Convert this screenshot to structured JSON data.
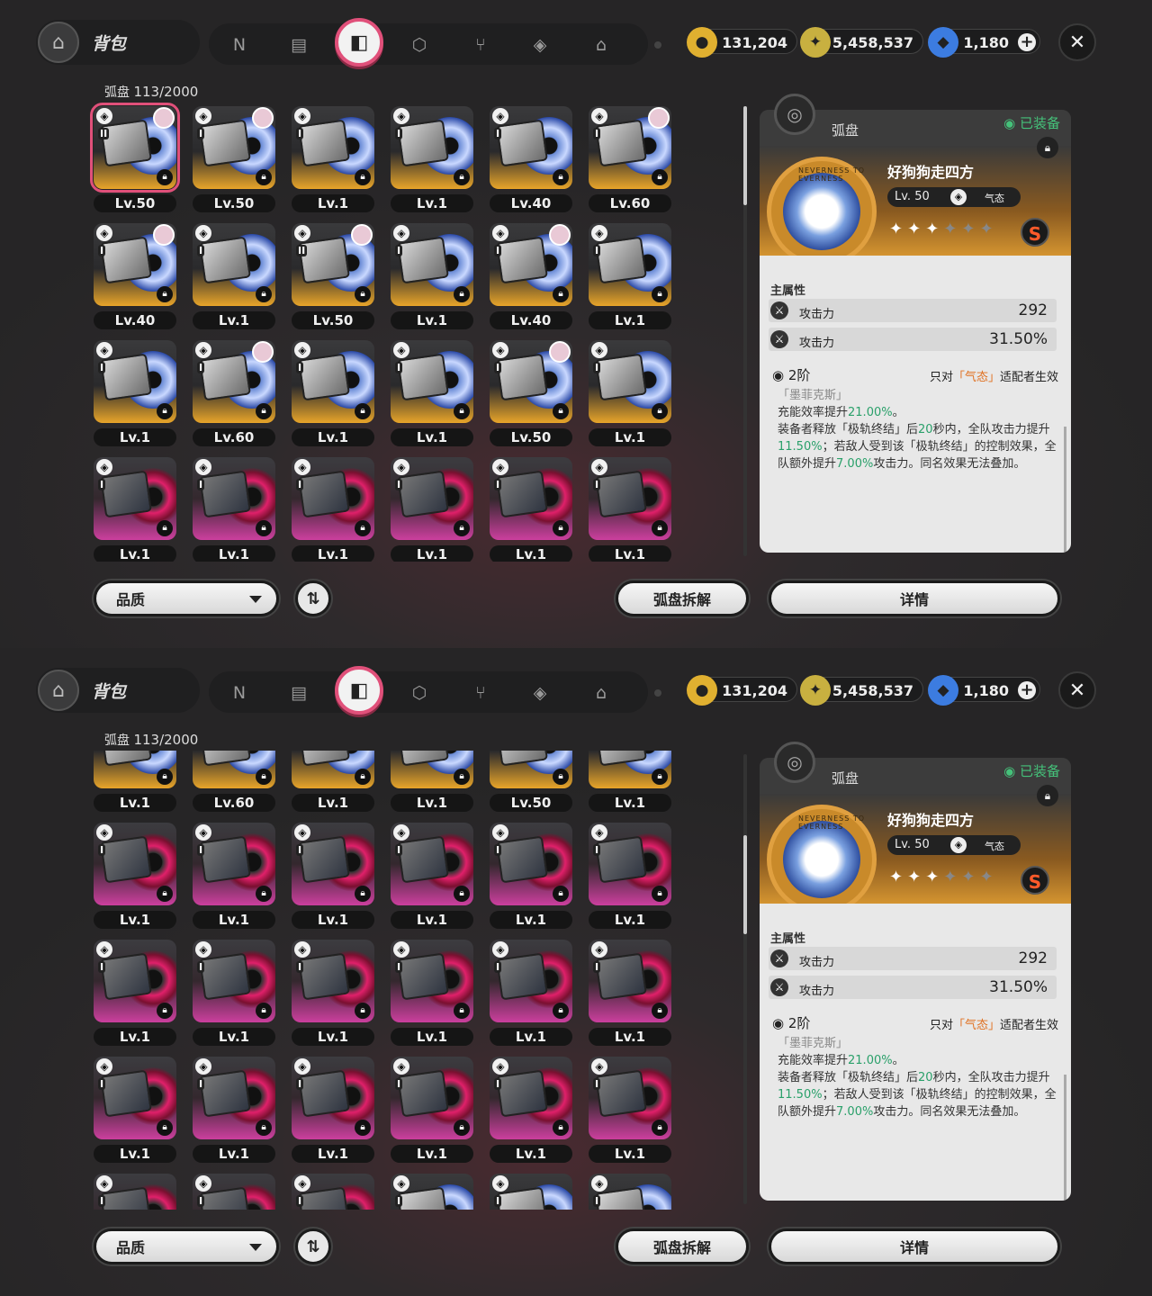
{
  "header": {
    "title": "背包",
    "tabs": [
      {
        "icon": "n-logo-icon",
        "glyph": "N"
      },
      {
        "icon": "gameboy-icon",
        "glyph": "▤"
      },
      {
        "icon": "disc-bag-icon",
        "glyph": "◧",
        "active": true
      },
      {
        "icon": "cube-icon",
        "glyph": "⬡"
      },
      {
        "icon": "utensils-icon",
        "glyph": "⑂"
      },
      {
        "icon": "cube-outline-icon",
        "glyph": "◈"
      },
      {
        "icon": "house-icon",
        "glyph": "⌂"
      }
    ],
    "currencies": [
      {
        "icon": "coin-icon",
        "value": "131,204",
        "color": "#e0b030"
      },
      {
        "icon": "ticket-icon",
        "value": "5,458,537",
        "color": "#c8b040"
      },
      {
        "icon": "polychrome-icon",
        "value": "1,180",
        "color": "#3c7ce0"
      }
    ],
    "close": "✕"
  },
  "inventory": {
    "label": "弧盘",
    "count": "113/2000"
  },
  "filter": {
    "label": "品质"
  },
  "buttons": {
    "sort": "⇅",
    "dismantle": "弧盘拆解",
    "details": "详情"
  },
  "panel": {
    "title": "弧盘",
    "equipped": "已装备",
    "name": "好狗狗走四方",
    "level": "Lv. 50",
    "attribute": "气态",
    "medal_text": "NEVERNESS TO EVERNESS",
    "stars_filled": 3,
    "stars_total": 6,
    "rank": "S",
    "main_label": "主属性",
    "stats": [
      {
        "name": "攻击力",
        "value": "292"
      },
      {
        "name": "攻击力",
        "value": "31.50%"
      }
    ],
    "tier": "2阶",
    "tier_hint_pre": "只对",
    "tier_hint_attr": "「气态」",
    "tier_hint_post": "适配者生效",
    "desc_sub": "「墨菲克斯」",
    "desc_l1_a": "充能效率提升",
    "desc_l1_b": "21.00%",
    "desc_l1_c": "。",
    "desc_l2_a": "装备者释放「极轨终结」后",
    "desc_l2_b": "20",
    "desc_l2_c": "秒内，全队攻击力提升",
    "desc_l2_d": "11.50%",
    "desc_l2_e": "；若敌人受到该「极轨终结」的控制效果，全队额外提升",
    "desc_l2_f": "7.00%",
    "desc_l2_g": "攻击力。同名效果无法叠加。"
  },
  "screen_top": {
    "rows": [
      [
        {
          "attr": "◈",
          "rank": "II",
          "av": true,
          "lv": "Lv.50",
          "g": "y",
          "sel": true
        },
        {
          "attr": "◈",
          "rank": "I",
          "av": true,
          "lv": "Lv.50",
          "g": "y"
        },
        {
          "attr": "◈",
          "rank": "I",
          "av": false,
          "lv": "Lv.1",
          "g": "y"
        },
        {
          "attr": "◈",
          "rank": "I",
          "av": false,
          "lv": "Lv.1",
          "g": "y"
        },
        {
          "attr": "◈",
          "rank": "I",
          "av": false,
          "lv": "Lv.40",
          "g": "y"
        },
        {
          "attr": "◈",
          "rank": "I",
          "av": true,
          "lv": "Lv.60",
          "g": "y"
        }
      ],
      [
        {
          "attr": "◈",
          "rank": "I",
          "av": true,
          "lv": "Lv.40",
          "g": "y"
        },
        {
          "attr": "◈",
          "rank": "I",
          "av": false,
          "lv": "Lv.1",
          "g": "y"
        },
        {
          "attr": "◈",
          "rank": "II",
          "av": true,
          "lv": "Lv.50",
          "g": "y"
        },
        {
          "attr": "◈",
          "rank": "I",
          "av": false,
          "lv": "Lv.1",
          "g": "y"
        },
        {
          "attr": "◈",
          "rank": "I",
          "av": true,
          "lv": "Lv.40",
          "g": "y"
        },
        {
          "attr": "◈",
          "rank": "I",
          "av": false,
          "lv": "Lv.1",
          "g": "y"
        }
      ],
      [
        {
          "attr": "◈",
          "rank": "I",
          "av": false,
          "lv": "Lv.1",
          "g": "y"
        },
        {
          "attr": "◈",
          "rank": "I",
          "av": true,
          "lv": "Lv.60",
          "g": "y"
        },
        {
          "attr": "◈",
          "rank": "I",
          "av": false,
          "lv": "Lv.1",
          "g": "y"
        },
        {
          "attr": "◈",
          "rank": "I",
          "av": false,
          "lv": "Lv.1",
          "g": "y"
        },
        {
          "attr": "◈",
          "rank": "I",
          "av": true,
          "lv": "Lv.50",
          "g": "y"
        },
        {
          "attr": "◈",
          "rank": "I",
          "av": false,
          "lv": "Lv.1",
          "g": "y"
        }
      ],
      [
        {
          "attr": "◈",
          "rank": "I",
          "av": false,
          "lv": "Lv.1",
          "g": "p"
        },
        {
          "attr": "◈",
          "rank": "I",
          "av": false,
          "lv": "Lv.1",
          "g": "p"
        },
        {
          "attr": "◈",
          "rank": "I",
          "av": false,
          "lv": "Lv.1",
          "g": "p"
        },
        {
          "attr": "◈",
          "rank": "I",
          "av": false,
          "lv": "Lv.1",
          "g": "p"
        },
        {
          "attr": "◈",
          "rank": "I",
          "av": false,
          "lv": "Lv.1",
          "g": "p"
        },
        {
          "attr": "◈",
          "rank": "I",
          "av": false,
          "lv": "Lv.1",
          "g": "p"
        }
      ]
    ]
  },
  "screen_bottom": {
    "rows": [
      [
        {
          "attr": "◈",
          "rank": "I",
          "av": false,
          "lv": "Lv.1",
          "g": "y"
        },
        {
          "attr": "◈",
          "rank": "I",
          "av": false,
          "lv": "Lv.60",
          "g": "y"
        },
        {
          "attr": "◈",
          "rank": "I",
          "av": false,
          "lv": "Lv.1",
          "g": "y"
        },
        {
          "attr": "◈",
          "rank": "I",
          "av": false,
          "lv": "Lv.1",
          "g": "y"
        },
        {
          "attr": "◈",
          "rank": "I",
          "av": false,
          "lv": "Lv.50",
          "g": "y"
        },
        {
          "attr": "◈",
          "rank": "I",
          "av": false,
          "lv": "Lv.1",
          "g": "y"
        }
      ],
      [
        {
          "attr": "◈",
          "rank": "I",
          "av": false,
          "lv": "Lv.1",
          "g": "p"
        },
        {
          "attr": "◈",
          "rank": "I",
          "av": false,
          "lv": "Lv.1",
          "g": "p"
        },
        {
          "attr": "◈",
          "rank": "I",
          "av": false,
          "lv": "Lv.1",
          "g": "p"
        },
        {
          "attr": "◈",
          "rank": "I",
          "av": false,
          "lv": "Lv.1",
          "g": "p"
        },
        {
          "attr": "◈",
          "rank": "I",
          "av": false,
          "lv": "Lv.1",
          "g": "p"
        },
        {
          "attr": "◈",
          "rank": "I",
          "av": false,
          "lv": "Lv.1",
          "g": "p"
        }
      ],
      [
        {
          "attr": "◈",
          "rank": "I",
          "av": false,
          "lv": "Lv.1",
          "g": "p"
        },
        {
          "attr": "◈",
          "rank": "I",
          "av": false,
          "lv": "Lv.1",
          "g": "p"
        },
        {
          "attr": "◈",
          "rank": "I",
          "av": false,
          "lv": "Lv.1",
          "g": "p"
        },
        {
          "attr": "◈",
          "rank": "I",
          "av": false,
          "lv": "Lv.1",
          "g": "p"
        },
        {
          "attr": "◈",
          "rank": "I",
          "av": false,
          "lv": "Lv.1",
          "g": "p"
        },
        {
          "attr": "◈",
          "rank": "I",
          "av": false,
          "lv": "Lv.1",
          "g": "p"
        }
      ],
      [
        {
          "attr": "◈",
          "rank": "I",
          "av": false,
          "lv": "Lv.1",
          "g": "p"
        },
        {
          "attr": "◈",
          "rank": "I",
          "av": false,
          "lv": "Lv.1",
          "g": "p"
        },
        {
          "attr": "◈",
          "rank": "I",
          "av": false,
          "lv": "Lv.1",
          "g": "p"
        },
        {
          "attr": "◈",
          "rank": "I",
          "av": false,
          "lv": "Lv.1",
          "g": "p"
        },
        {
          "attr": "◈",
          "rank": "I",
          "av": false,
          "lv": "Lv.1",
          "g": "p"
        },
        {
          "attr": "◈",
          "rank": "I",
          "av": false,
          "lv": "Lv.1",
          "g": "p"
        }
      ],
      [
        {
          "attr": "◈",
          "rank": "I",
          "av": false,
          "lv": "",
          "g": "p"
        },
        {
          "attr": "◈",
          "rank": "I",
          "av": false,
          "lv": "",
          "g": "p"
        },
        {
          "attr": "◈",
          "rank": "I",
          "av": false,
          "lv": "",
          "g": "p"
        },
        {
          "attr": "◈",
          "rank": "I",
          "av": false,
          "lv": "",
          "g": "y"
        },
        {
          "attr": "◈",
          "rank": "I",
          "av": false,
          "lv": "",
          "g": "y"
        },
        {
          "attr": "◈",
          "rank": "I",
          "av": false,
          "lv": "",
          "g": "y"
        }
      ]
    ]
  }
}
